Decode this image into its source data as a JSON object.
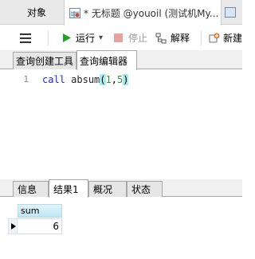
{
  "tabs": {
    "objects": "对象",
    "query": "* 无标题 @youoil (测试机My..."
  },
  "toolbar": {
    "run": "运行",
    "run_dropdown": "▾",
    "stop": "停止",
    "explain": "解释",
    "new_build": "新建"
  },
  "query_tabs": {
    "builder": "查询创建工具",
    "editor": "查询编辑器"
  },
  "editor": {
    "line_number": "1",
    "code": {
      "keyword": "call",
      "function": "absum",
      "open_paren": "(",
      "arg1": "1",
      "comma": ",",
      "arg2": "5",
      "close_paren": ")"
    }
  },
  "result_tabs": {
    "info": "信息",
    "result1": "结果1",
    "overview": "概况",
    "status": "状态"
  },
  "grid": {
    "columns": [
      "sum"
    ],
    "rows": [
      [
        "6"
      ]
    ]
  },
  "colors": {
    "run_icon": "#22a322",
    "stop_icon": "#e8a0a0",
    "header_bg": "#bfe6f3",
    "highlight": "#a8ecec"
  }
}
